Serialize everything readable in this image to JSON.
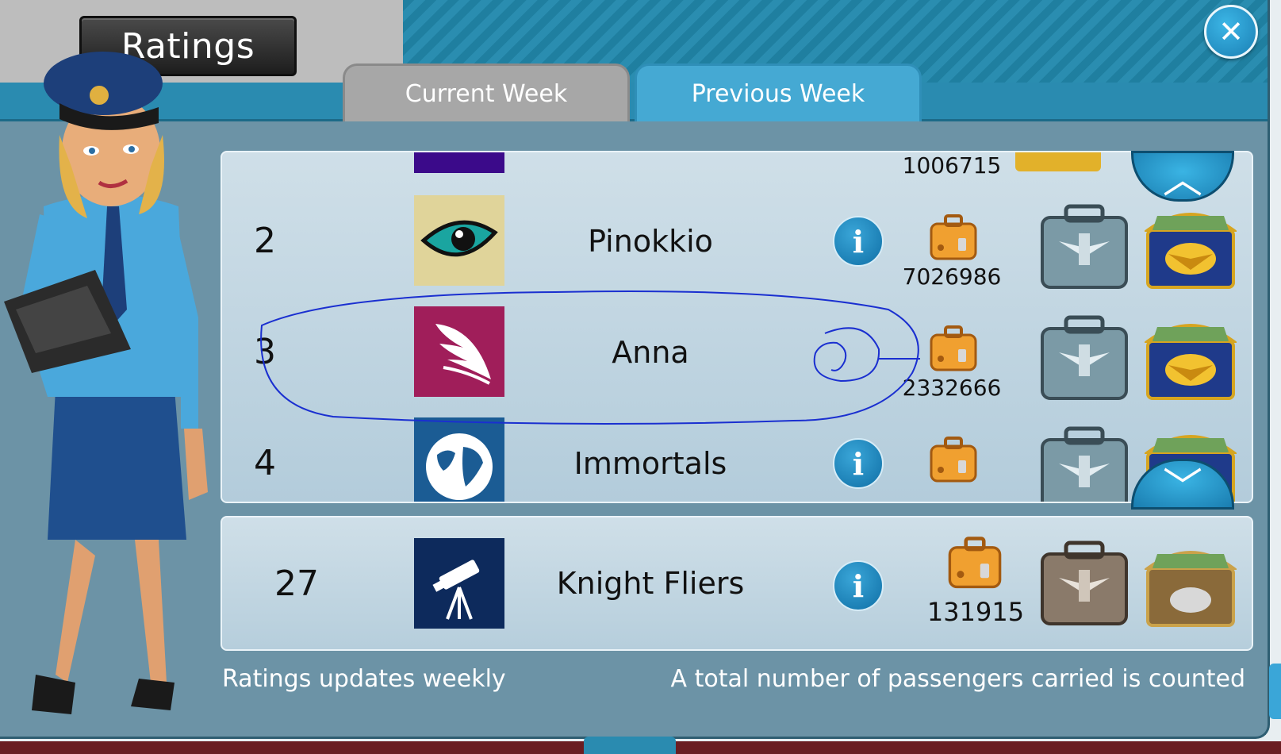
{
  "title": "Ratings",
  "tabs": [
    {
      "label": "Current Week",
      "active": false
    },
    {
      "label": "Previous Week",
      "active": true
    }
  ],
  "leaderboard": {
    "partial_top_row": {
      "count": "1006715"
    },
    "rows": [
      {
        "rank": "2",
        "name": "Pinokkio",
        "logo_icon": "eye-icon",
        "logo_bg": "#e0d49a",
        "count": "7026986"
      },
      {
        "rank": "3",
        "name": "Anna",
        "logo_icon": "wing-icon",
        "logo_bg": "#a01e5a",
        "count": "2332666",
        "annotated": true
      },
      {
        "rank": "4",
        "name": "Immortals",
        "logo_icon": "globe-icon",
        "logo_bg": "#1b5c94",
        "count": ""
      }
    ]
  },
  "my_entry": {
    "rank": "27",
    "name": "Knight Fliers",
    "logo_icon": "telescope-icon",
    "logo_bg": "#0d2a5c",
    "count": "131915"
  },
  "footer": {
    "left": "Ratings updates weekly",
    "right": "A total number of passengers carried is counted"
  },
  "colors": {
    "accent": "#2a8bb0",
    "panel": "#6c93a6",
    "annotation": "#1a2fd0"
  }
}
